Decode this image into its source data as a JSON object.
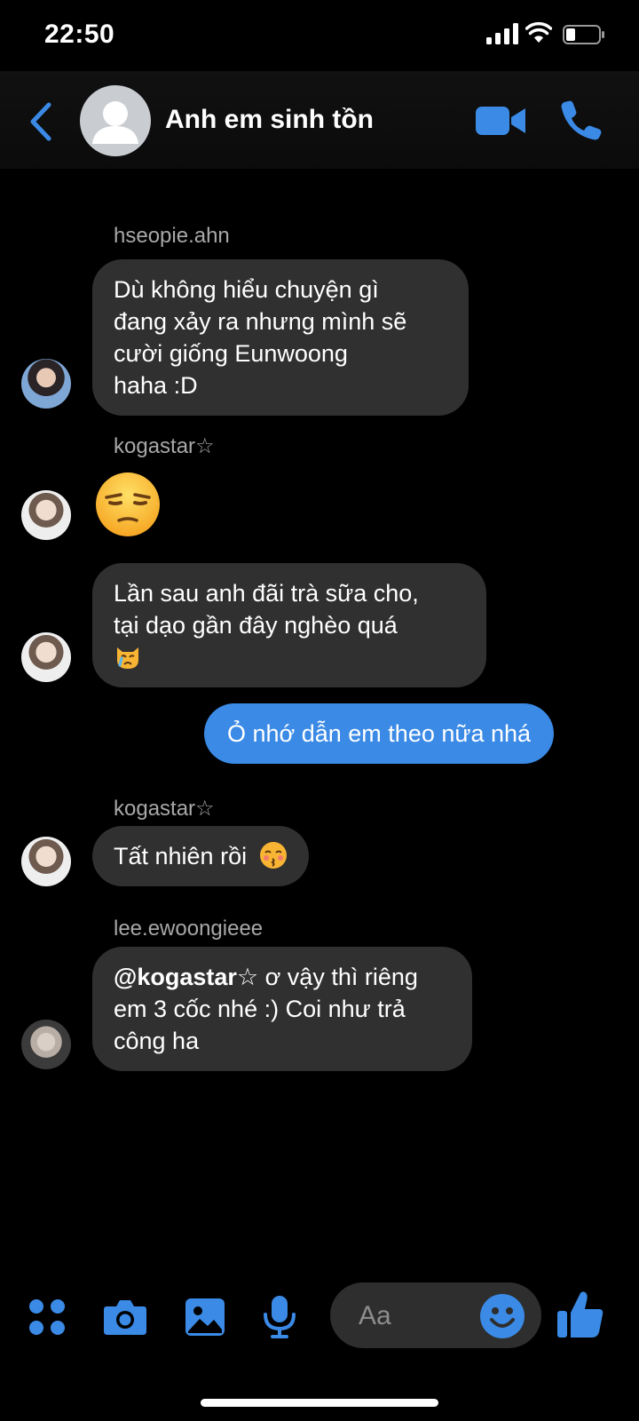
{
  "status_bar": {
    "time": "22:50"
  },
  "header": {
    "title": "Anh em sinh tồn"
  },
  "messages": [
    {
      "sender": "hseopie.ahn",
      "lines": [
        "Dù không hiểu chuyện gì",
        "đang xảy ra nhưng mình sẽ",
        "cười giống Eunwoong",
        "haha :D"
      ]
    },
    {
      "sender": "kogastar☆",
      "emoji": "unamused-face-emoji"
    },
    {
      "lines": [
        "Lần sau anh đãi trà sữa cho,",
        "tại dạo gần đây nghèo quá"
      ],
      "emoji": "crying-cat-emoji"
    },
    {
      "outgoing": true,
      "text": "Ỏ nhớ dẫn em theo nữa nhá"
    },
    {
      "sender": "kogastar☆",
      "text": "Tất nhiên rồi",
      "emoji": "kissing-face-emoji"
    },
    {
      "sender": "lee.ewoongieee",
      "mention": "@kogastar☆",
      "lines": [
        " ơ vậy thì riêng",
        "em 3 cốc nhé :) Coi như trả",
        "công ha"
      ]
    }
  ],
  "composer": {
    "placeholder": "Aa"
  },
  "colors": {
    "accent": "#3a8ae6",
    "incoming_bubble": "#303030",
    "background": "#000000"
  },
  "icons": [
    "back-chevron-icon",
    "video-camera-icon",
    "phone-icon",
    "apps-grid-icon",
    "camera-icon",
    "photo-icon",
    "microphone-icon",
    "smiley-icon",
    "thumbs-up-icon"
  ]
}
